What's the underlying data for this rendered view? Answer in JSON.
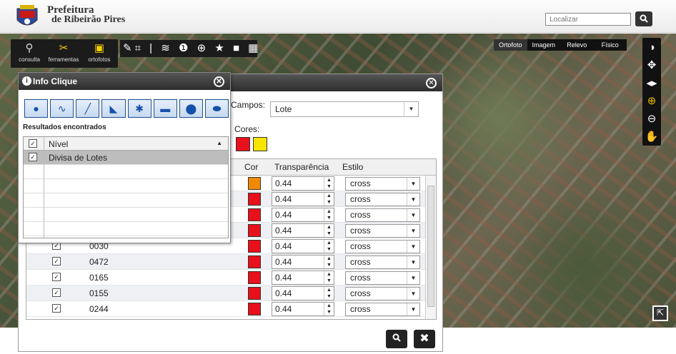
{
  "header": {
    "brand_line1": "Prefeitura",
    "brand_line2": "de Ribeirão Pires",
    "search_placeholder": "Localizar",
    "search_button_icon": "search-icon"
  },
  "toolbar": {
    "items": [
      {
        "label": "consulta",
        "icon": "search-icon"
      },
      {
        "label": "ferramentas",
        "icon": "tools-icon"
      },
      {
        "label": "ortofotos",
        "icon": "photo-icon"
      }
    ],
    "tools": "✎⌗ | ≋ ❶ ⊕ ★ ■ ▦"
  },
  "map_layers": [
    "Ortofoto",
    "Imagem",
    "Relevo",
    "Físico"
  ],
  "dialog": {
    "campos_label": "Campos:",
    "campos_value": "Lote",
    "cores_label": "Cores:",
    "colors": [
      "#e8101a",
      "#f7e400"
    ],
    "columns": [
      "Cor",
      "Transparência",
      "Estilo"
    ],
    "rows": [
      {
        "value": "",
        "color": "#f08a00",
        "transp": "0.44",
        "style": "cross"
      },
      {
        "value": "",
        "color": "#e8101a",
        "transp": "0.44",
        "style": "cross"
      },
      {
        "value": "",
        "color": "#e8101a",
        "transp": "0.44",
        "style": "cross"
      },
      {
        "value": "",
        "color": "#e8101a",
        "transp": "0.44",
        "style": "cross"
      },
      {
        "value": "0030",
        "color": "#e8101a",
        "transp": "0.44",
        "style": "cross"
      },
      {
        "value": "0472",
        "color": "#e8101a",
        "transp": "0.44",
        "style": "cross"
      },
      {
        "value": "0165",
        "color": "#e8101a",
        "transp": "0.44",
        "style": "cross"
      },
      {
        "value": "0155",
        "color": "#e8101a",
        "transp": "0.44",
        "style": "cross"
      },
      {
        "value": "0244",
        "color": "#e8101a",
        "transp": "0.44",
        "style": "cross"
      }
    ]
  },
  "info": {
    "title": "Info Clique",
    "results_title": "Resultados encontrados",
    "column": "Nível",
    "rows": [
      "Divisa de Lotes"
    ]
  }
}
